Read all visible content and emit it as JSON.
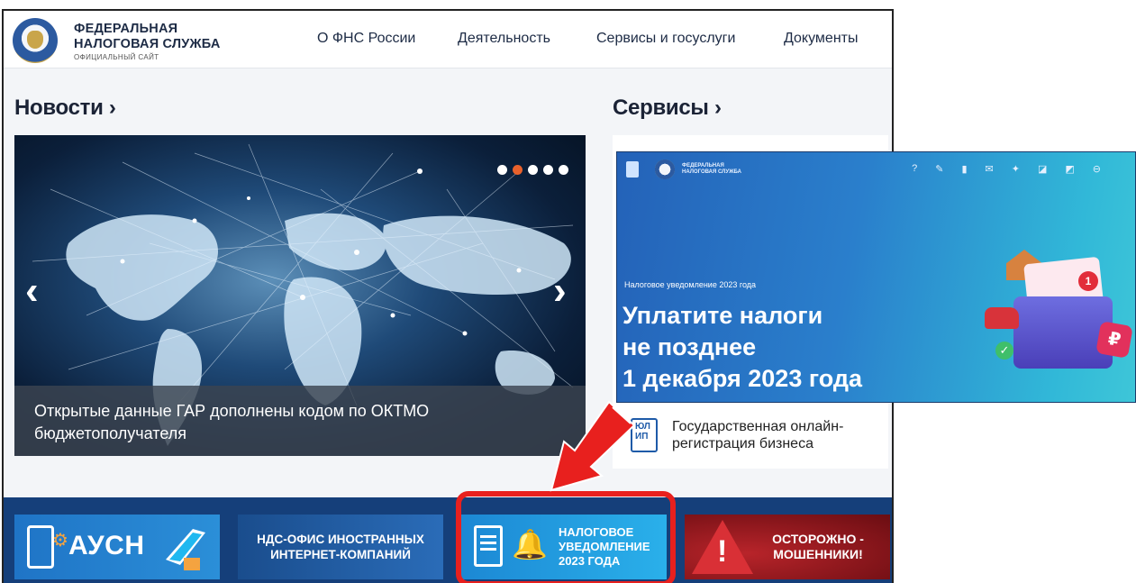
{
  "header": {
    "logo_line1": "ФЕДЕРАЛЬНАЯ",
    "logo_line2": "НАЛОГОВАЯ СЛУЖБА",
    "logo_sub": "ОФИЦИАЛЬНЫЙ САЙТ",
    "nav": [
      "О ФНС России",
      "Деятельность",
      "Сервисы и госуслуги",
      "Документы"
    ]
  },
  "news": {
    "title": "Новости ›",
    "slider_caption": "Открытые данные ГАР дополнены кодом по ОКТМО бюджетополучателя",
    "dots_count": 5,
    "active_dot": 1,
    "prev_arrow": "‹",
    "next_arrow": "›"
  },
  "services": {
    "title": "Сервисы ›",
    "item_icon_text": "ЮЛ ИП",
    "item_text": "Государственная онлайн-регистрация бизнеса"
  },
  "banners": [
    {
      "text": "АУСН",
      "icon": "terminal-icon"
    },
    {
      "text": "НДС-ОФИС ИНОСТРАННЫХ ИНТЕРНЕТ-КОМПАНИЙ"
    },
    {
      "text": "НАЛОГОВОЕ УВЕДОМЛЕНИЕ 2023 ГОДА",
      "icon": "bell-icon"
    },
    {
      "text": "ОСТОРОЖНО - МОШЕННИКИ!",
      "icon": "warning-icon"
    }
  ],
  "overlay": {
    "logo_text_1": "ФЕДЕРАЛЬНАЯ",
    "logo_text_2": "НАЛОГОВАЯ СЛУЖБА",
    "small_label": "Налоговое уведомление 2023 года",
    "title_line1": "Уплатите налоги",
    "title_line2": "не позднее",
    "title_line3": "1 декабря 2023 года",
    "badge": "1",
    "ruble": "₽",
    "check": "✓"
  },
  "colors": {
    "highlight": "#e8201e",
    "banner_strip": "#153f7a",
    "active_dot": "#e8612c"
  }
}
